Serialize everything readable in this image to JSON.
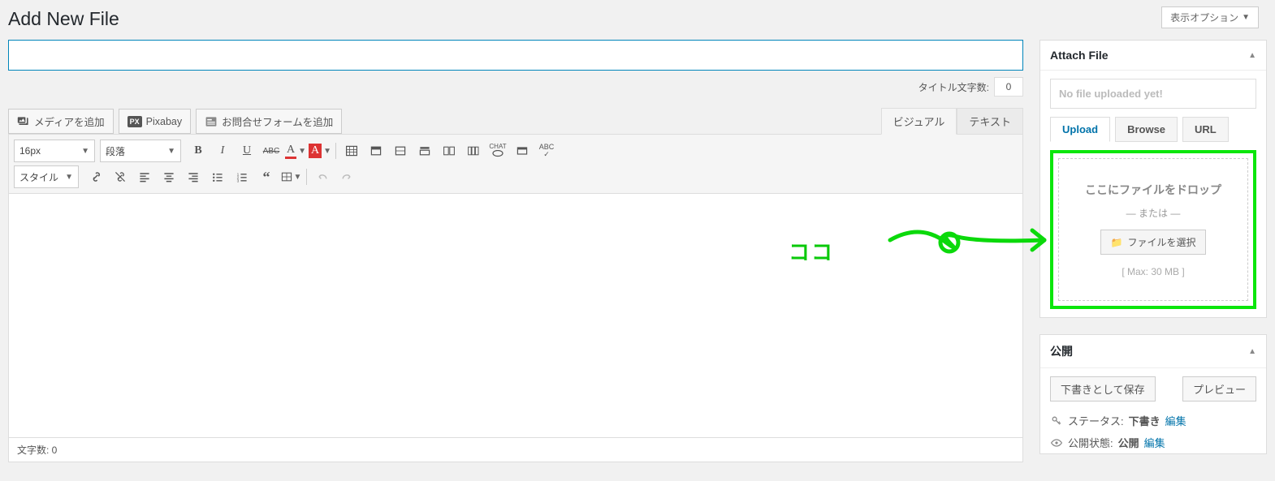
{
  "header": {
    "page_title": "Add New File",
    "screen_options": "表示オプション"
  },
  "title": {
    "value": "",
    "count_label": "タイトル文字数:",
    "count_value": "0"
  },
  "media_buttons": {
    "add_media": "メディアを追加",
    "pixabay": "Pixabay",
    "contact_form": "お問合せフォームを追加"
  },
  "editor_tabs": {
    "visual": "ビジュアル",
    "text": "テキスト"
  },
  "toolbar": {
    "font_size": "16px",
    "format": "段落",
    "style": "スタイル"
  },
  "footer": {
    "char_count": "文字数: 0"
  },
  "annotation": {
    "text": "ココ"
  },
  "sidebar": {
    "attach": {
      "title": "Attach File",
      "no_file": "No file uploaded yet!",
      "tabs": {
        "upload": "Upload",
        "browse": "Browse",
        "url": "URL"
      },
      "drop_text": "ここにファイルをドロップ",
      "or_text": "— または —",
      "select_btn": "ファイルを選択",
      "max_text": "[ Max: 30 MB ]"
    },
    "publish": {
      "title": "公開",
      "save_draft": "下書きとして保存",
      "preview": "プレビュー",
      "status_label": "ステータス:",
      "status_value": "下書き",
      "visibility_label": "公開状態:",
      "visibility_value": "公開",
      "edit": "編集"
    }
  }
}
